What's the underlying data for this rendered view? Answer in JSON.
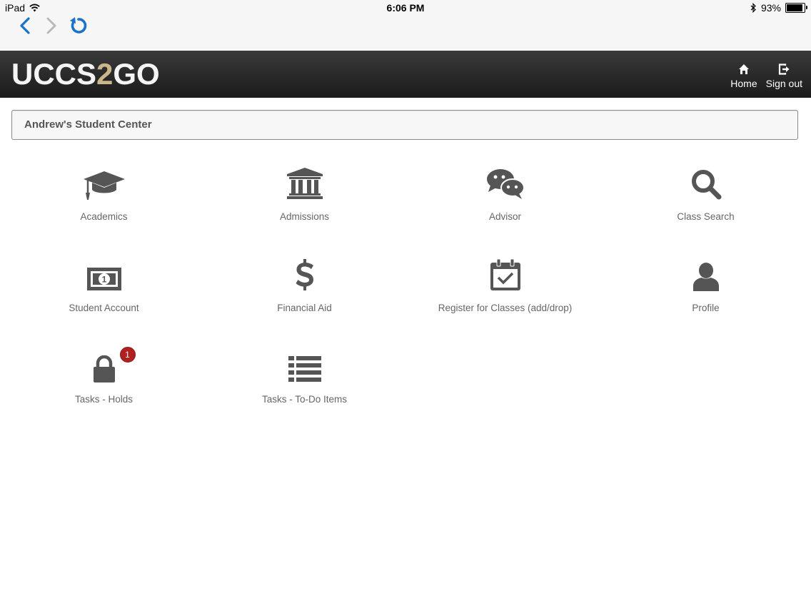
{
  "status_bar": {
    "device": "iPad",
    "time": "6:06 PM",
    "battery": "93%",
    "battery_level": 0.93
  },
  "browser": {
    "back": "chevron-left-icon",
    "forward": "chevron-right-icon",
    "reload": "reload-icon"
  },
  "header": {
    "logo_part1": "UCCS",
    "logo_part2": "2",
    "logo_part3": "GO",
    "home_label": "Home",
    "signout_label": "Sign out"
  },
  "page": {
    "title": "Andrew's Student Center"
  },
  "tiles": [
    {
      "label": "Academics",
      "icon": "graduation-cap-icon"
    },
    {
      "label": "Admissions",
      "icon": "institution-icon"
    },
    {
      "label": "Advisor",
      "icon": "chat-bubbles-icon"
    },
    {
      "label": "Class Search",
      "icon": "search-icon"
    },
    {
      "label": "Student Account",
      "icon": "money-icon"
    },
    {
      "label": "Financial Aid",
      "icon": "dollar-icon"
    },
    {
      "label": "Register for Classes (add/drop)",
      "icon": "calendar-check-icon"
    },
    {
      "label": "Profile",
      "icon": "user-icon"
    },
    {
      "label": "Tasks - Holds",
      "icon": "lock-icon",
      "badge": "1"
    },
    {
      "label": "Tasks - To-Do Items",
      "icon": "list-icon"
    }
  ],
  "colors": {
    "accent_blue": "#1a73c9",
    "header_dark": "#222222",
    "icon_gray": "#555555",
    "badge_red": "#b0201f",
    "logo_gold": "#c9b98a"
  }
}
